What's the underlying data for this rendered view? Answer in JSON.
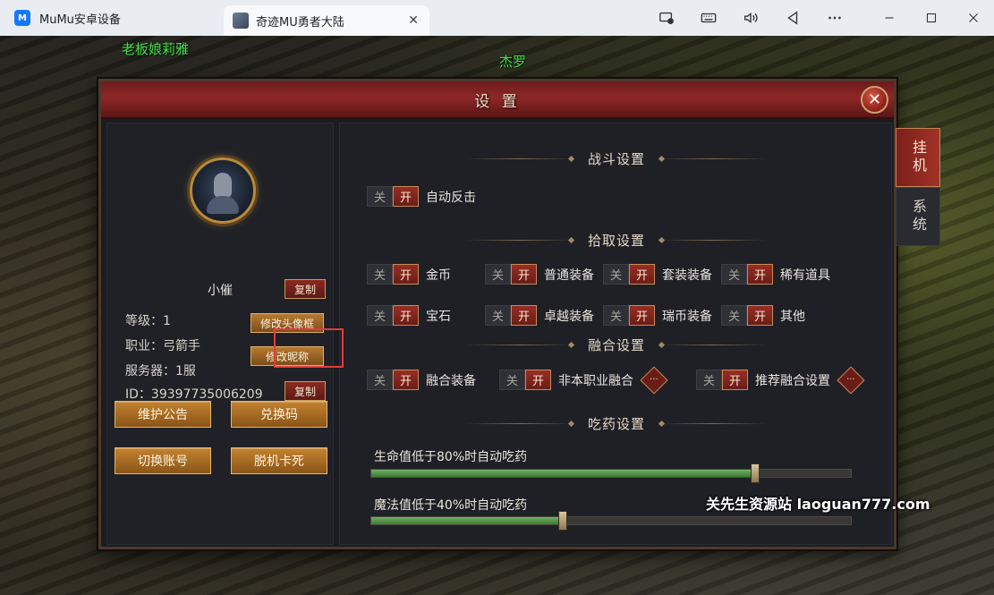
{
  "chrome": {
    "app_tab_title": "MuMu安卓设备",
    "app_logo_text": "M",
    "game_tab_title": "奇迹MU勇者大陆",
    "tab_close": "✕",
    "tools": [
      "screen-record-icon",
      "keyboard-icon",
      "volume-icon",
      "back-icon",
      "more-icon",
      "minimize-icon",
      "maximize-icon",
      "close-icon"
    ]
  },
  "scene": {
    "npc_names": [
      "老板娘莉雅",
      "杰罗"
    ]
  },
  "dialog": {
    "title": "设 置",
    "close_label": "✕",
    "profile": {
      "name": "小催",
      "copy_name_label": "复制",
      "level": "等级：1",
      "class": "职业：弓箭手",
      "server": "服务器：1服",
      "id": "ID：39397735006209",
      "edit_frame_label": "修改头像框",
      "edit_nickname_label": "修改昵称",
      "copy_id_label": "复制"
    },
    "buttons": {
      "notice": "维护公告",
      "redeem": "兑换码",
      "switch_account": "切换账号",
      "unstuck": "脱机卡死"
    },
    "toggle_text": {
      "off": "关",
      "on": "开"
    },
    "sections": {
      "combat": {
        "title": "战斗设置",
        "items": [
          {
            "label": "自动反击",
            "state": "on"
          }
        ]
      },
      "pickup": {
        "title": "拾取设置",
        "items": [
          {
            "label": "金币",
            "state": "on"
          },
          {
            "label": "普通装备",
            "state": "on"
          },
          {
            "label": "套装装备",
            "state": "on"
          },
          {
            "label": "稀有道具",
            "state": "on"
          },
          {
            "label": "宝石",
            "state": "on"
          },
          {
            "label": "卓越装备",
            "state": "on"
          },
          {
            "label": "瑞币装备",
            "state": "on"
          },
          {
            "label": "其他",
            "state": "on"
          }
        ]
      },
      "fusion": {
        "title": "融合设置",
        "items": [
          {
            "label": "融合装备",
            "state": "on"
          },
          {
            "label": "非本职业融合",
            "state": "on",
            "more": "···"
          },
          {
            "label": "推荐融合设置",
            "state": "on",
            "more": "···"
          }
        ]
      },
      "potion": {
        "title": "吃药设置",
        "sliders": [
          {
            "label": "生命值低于80%时自动吃药",
            "value_percent": 80
          },
          {
            "label": "魔法值低于40%时自动吃药",
            "value_percent": 40
          }
        ]
      }
    },
    "side_tabs": [
      {
        "label": "挂机",
        "active": true
      },
      {
        "label": "系统",
        "active": false
      }
    ]
  },
  "watermark": "关先生资源站 laoguan777.com",
  "colors": {
    "accent_red": "#8e2727",
    "gold": "#c3822f",
    "slider_green": "#6fb063",
    "npc_green": "#46e34a",
    "highlight": "#e23b3b"
  }
}
